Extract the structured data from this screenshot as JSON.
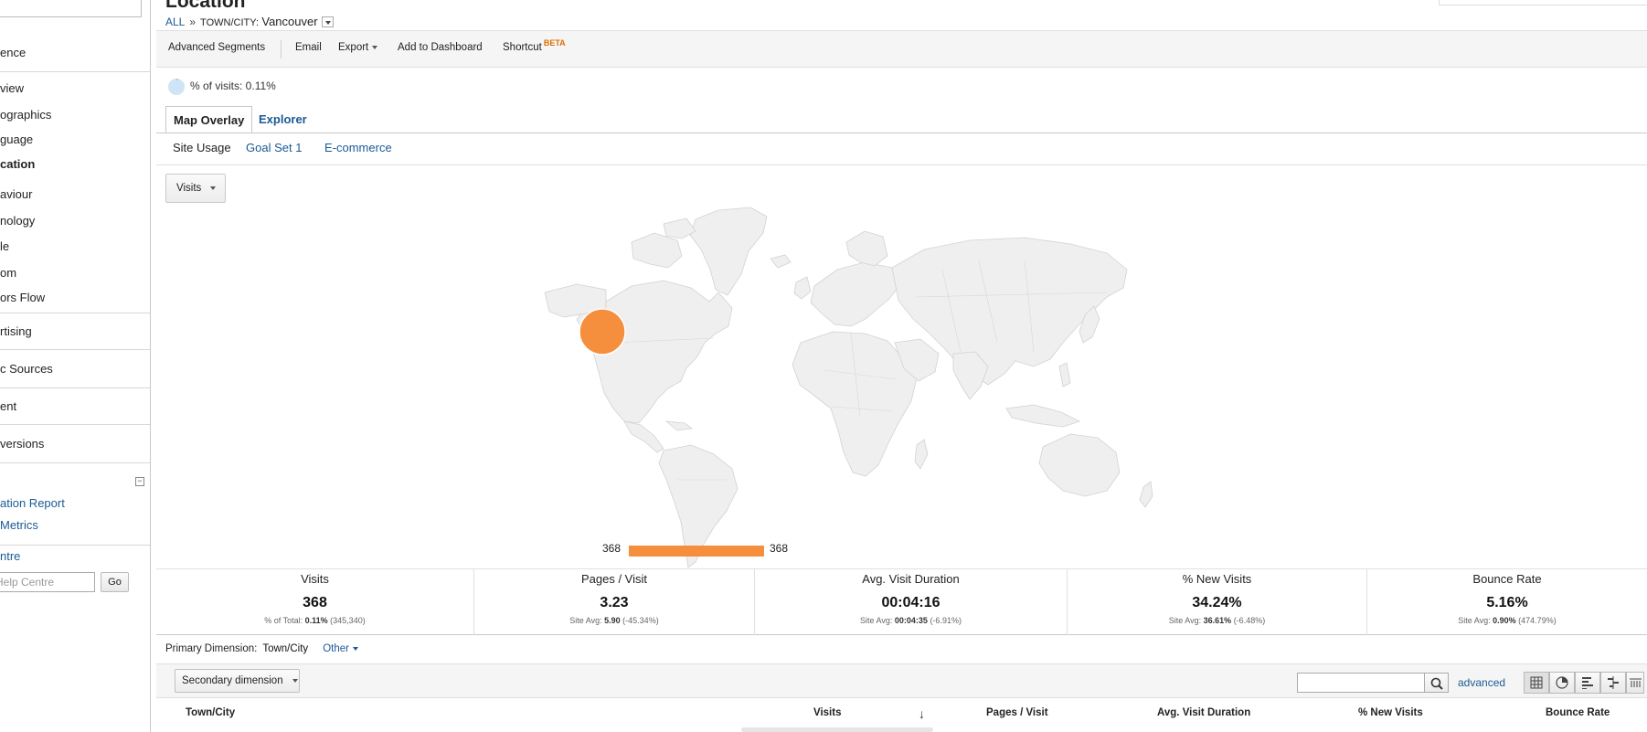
{
  "sidebar": {
    "items": [
      {
        "label": "ence",
        "bold": false
      },
      {
        "label": "view",
        "bold": false
      },
      {
        "label": "ographics",
        "bold": false
      },
      {
        "label": "guage",
        "bold": false
      },
      {
        "label": "cation",
        "bold": true
      },
      {
        "label": "aviour",
        "bold": false
      },
      {
        "label": "nology",
        "bold": false
      },
      {
        "label": "le",
        "bold": false
      },
      {
        "label": "om",
        "bold": false
      },
      {
        "label": "ors Flow",
        "bold": false
      },
      {
        "label": "rtising",
        "bold": false
      },
      {
        "label": "c Sources",
        "bold": false
      },
      {
        "label": "ent",
        "bold": false
      },
      {
        "label": "versions",
        "bold": false
      }
    ],
    "links": [
      "ation Report",
      "Metrics",
      "ntre"
    ],
    "help_placeholder": "Help Centre",
    "go_label": "Go",
    "collapse_label": "−"
  },
  "header": {
    "title": "Location",
    "breadcrumb_all": "ALL",
    "breadcrumb_sep": "»",
    "breadcrumb_dim_label": "TOWN/CITY:",
    "breadcrumb_dim_value": "Vancouver"
  },
  "toolbar": {
    "advanced_segments": "Advanced Segments",
    "email": "Email",
    "export": "Export",
    "add_to_dashboard": "Add to Dashboard",
    "shortcut": "Shortcut",
    "beta": "BETA"
  },
  "summary": {
    "pct_of_visits": "% of visits: 0.11%",
    "pct_value": 0.0011
  },
  "tabs": [
    {
      "label": "Map Overlay",
      "active": true
    },
    {
      "label": "Explorer",
      "active": false
    }
  ],
  "subtabs": [
    {
      "label": "Site Usage",
      "active": true
    },
    {
      "label": "Goal Set 1",
      "active": false
    },
    {
      "label": "E-commerce",
      "active": false
    }
  ],
  "map": {
    "metric_selector": "Visits",
    "legend_min": "368",
    "legend_max": "368",
    "bubble_color": "#f58e3d",
    "land_color": "#efefef",
    "border_color": "#d6d6d6"
  },
  "metrics": [
    {
      "name": "Visits",
      "value": "368",
      "sub_prefix": "% of Total: ",
      "sub_bold": "0.11%",
      "sub_suffix": " (345,340)"
    },
    {
      "name": "Pages / Visit",
      "value": "3.23",
      "sub_prefix": "Site Avg: ",
      "sub_bold": "5.90",
      "sub_suffix": " (-45.34%)"
    },
    {
      "name": "Avg. Visit Duration",
      "value": "00:04:16",
      "sub_prefix": "Site Avg: ",
      "sub_bold": "00:04:35",
      "sub_suffix": " (-6.91%)"
    },
    {
      "name": "% New Visits",
      "value": "34.24%",
      "sub_prefix": "Site Avg: ",
      "sub_bold": "36.61%",
      "sub_suffix": " (-6.48%)"
    },
    {
      "name": "Bounce Rate",
      "value": "5.16%",
      "sub_prefix": "Site Avg: ",
      "sub_bold": "0.90%",
      "sub_suffix": " (474.79%)"
    }
  ],
  "primary_dimension": {
    "label": "Primary Dimension:",
    "current": "Town/City",
    "other": "Other"
  },
  "controls": {
    "secondary_dimension": "Secondary dimension",
    "advanced": "advanced",
    "search_value": ""
  },
  "table": {
    "columns": [
      "Town/City",
      "Visits",
      "Pages / Visit",
      "Avg. Visit Duration",
      "% New Visits",
      "Bounce Rate"
    ]
  }
}
